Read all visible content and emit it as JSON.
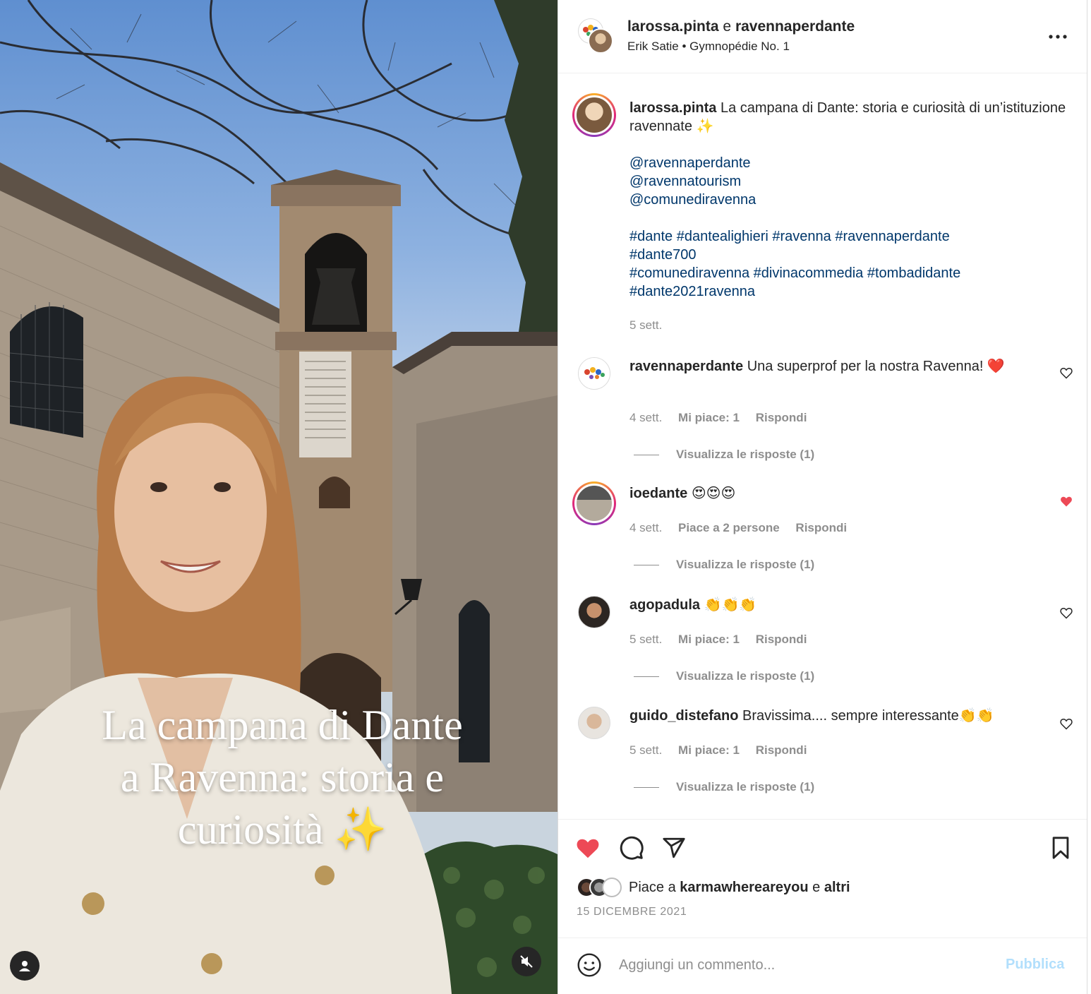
{
  "media": {
    "overlay_lines": [
      "La campana di Dante",
      "a Ravenna: storia e",
      "curiosità ✨"
    ]
  },
  "header": {
    "user1": "larossa.pinta",
    "joiner": "e",
    "user2": "ravennaperdante",
    "artist": "Erik Satie",
    "separator": "•",
    "track": "Gymnopédie No. 1"
  },
  "caption": {
    "username": "larossa.pinta",
    "text": "La campana di Dante: storia e curiosità di un’istituzione ravennate ✨",
    "mentions": [
      "@ravennaperdante",
      "@ravennatourism",
      "@comunediravenna"
    ],
    "hashtags_lines": [
      "#dante #dantealighieri #ravenna #ravennaperdante",
      "#dante700",
      "#comunediravenna #divinacommedia #tombadidante",
      "#dante2021ravenna"
    ],
    "time": "5 sett."
  },
  "comments": [
    {
      "username": "ravennaperdante",
      "text": "Una superprof per la nostra Ravenna! ❤️",
      "time": "4 sett.",
      "likes": "Mi piace: 1",
      "reply": "Rispondi",
      "view_replies": "Visualizza le risposte (1)",
      "liked": false
    },
    {
      "username": "ioedante",
      "text": "😍😍😍",
      "time": "4 sett.",
      "likes": "Piace a 2 persone",
      "reply": "Rispondi",
      "view_replies": "Visualizza le risposte (1)",
      "liked": true
    },
    {
      "username": "agopadula",
      "text": "👏👏👏",
      "time": "5 sett.",
      "likes": "Mi piace: 1",
      "reply": "Rispondi",
      "view_replies": "Visualizza le risposte (1)",
      "liked": false
    },
    {
      "username": "guido_distefano",
      "text": "Bravissima.... sempre interessante👏👏",
      "time": "5 sett.",
      "likes": "Mi piace: 1",
      "reply": "Rispondi",
      "view_replies": "Visualizza le risposte (1)",
      "liked": false
    }
  ],
  "actions": {
    "likes_prefix": "Piace a",
    "likes_user": "karmawhereareyou",
    "likes_joiner": "e",
    "likes_others": "altri",
    "date": "15 DICEMBRE 2021"
  },
  "add_comment": {
    "placeholder": "Aggiungi un commento...",
    "publish": "Pubblica"
  },
  "colors": {
    "like_red": "#ed4956",
    "link_blue": "#00376b",
    "muted": "#8e8e8e",
    "publish_disabled": "#b2dffc"
  },
  "icons": {
    "like": "heart-filled-icon",
    "comment": "comment-bubble-icon",
    "share": "paper-plane-icon",
    "save": "bookmark-icon",
    "more": "more-horizontal-icon",
    "emoji": "smiley-icon",
    "mute": "speaker-muted-icon",
    "tagged": "user-icon"
  }
}
